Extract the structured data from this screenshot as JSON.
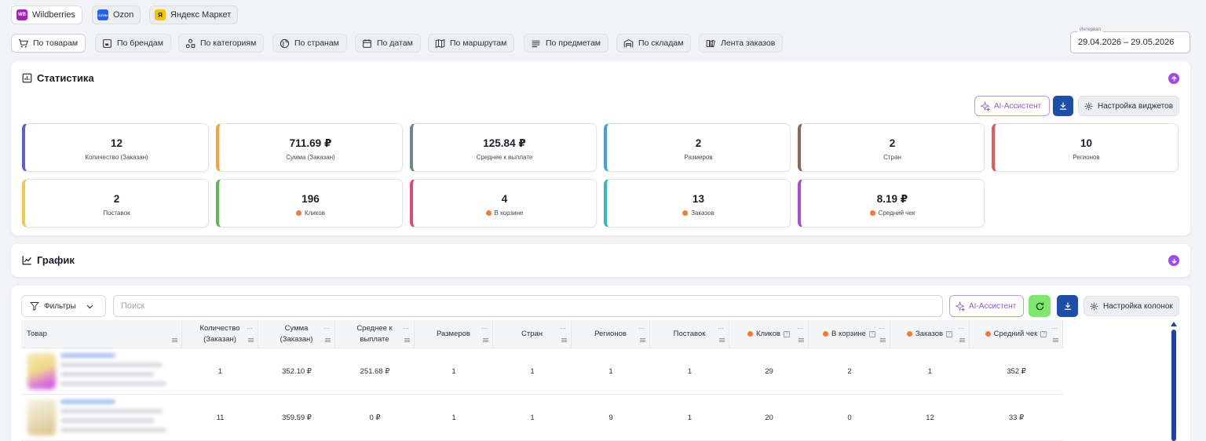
{
  "marketplaces": [
    {
      "label": "Wildberries",
      "logo_text": "WB",
      "color": "#a51fb8"
    },
    {
      "label": "Ozon",
      "logo_text": "OZON",
      "color": "#2563eb"
    },
    {
      "label": "Яндекс Маркет",
      "logo_text": "Я",
      "color": "#f7c400"
    }
  ],
  "nav": [
    {
      "label": "По товарам",
      "icon": "cart-icon"
    },
    {
      "label": "По брендам",
      "icon": "brand-icon"
    },
    {
      "label": "По категориям",
      "icon": "categories-icon"
    },
    {
      "label": "По странам",
      "icon": "globe-icon"
    },
    {
      "label": "По датам",
      "icon": "calendar-icon"
    },
    {
      "label": "По маршрутам",
      "icon": "map-icon"
    },
    {
      "label": "По предметам",
      "icon": "list-icon"
    },
    {
      "label": "По складам",
      "icon": "warehouse-icon"
    },
    {
      "label": "Лента заказов",
      "icon": "feed-icon"
    }
  ],
  "date_range": {
    "label": "Интервал",
    "value": "29.04.2026 – 29.05.2026"
  },
  "stats": {
    "title": "Статистика",
    "ai_label": "AI-Ассистент",
    "settings_label": "Настройка виджетов",
    "cards": [
      {
        "value": "12",
        "label": "Количество (Заказан)",
        "color": "#5b5fc7",
        "dot": false
      },
      {
        "value": "711.69 ₽",
        "label": "Сумма (Заказан)",
        "color": "#f5a43c",
        "dot": false
      },
      {
        "value": "125.84 ₽",
        "label": "Среднее к выплате",
        "color": "#6b8594",
        "dot": false
      },
      {
        "value": "2",
        "label": "Размеров",
        "color": "#3aa3e0",
        "dot": false
      },
      {
        "value": "2",
        "label": "Стран",
        "color": "#8a6a55",
        "dot": false
      },
      {
        "value": "10",
        "label": "Регионов",
        "color": "#e35a5a",
        "dot": false
      },
      {
        "value": "2",
        "label": "Поставок",
        "color": "#f2c94c",
        "dot": false
      },
      {
        "value": "196",
        "label": "Кликов",
        "color": "#5fb55f",
        "dot": true
      },
      {
        "value": "4",
        "label": "В корзине",
        "color": "#e04875",
        "dot": true
      },
      {
        "value": "13",
        "label": "Заказов",
        "color": "#37b7c4",
        "dot": true
      },
      {
        "value": "8.19 ₽",
        "label": "Средний чек",
        "color": "#a84fd1",
        "dot": true
      }
    ]
  },
  "graph": {
    "title": "График"
  },
  "table": {
    "filters_label": "Фильтры",
    "search_placeholder": "Поиск",
    "ai_label": "AI-Ассистент",
    "columns_settings_label": "Настройка колонок",
    "columns": [
      {
        "label": "Товар",
        "dot": false,
        "help": false
      },
      {
        "label": "Количество (Заказан)",
        "dot": false,
        "help": false
      },
      {
        "label": "Сумма (Заказан)",
        "dot": false,
        "help": false
      },
      {
        "label": "Среднее к выплате",
        "dot": false,
        "help": false
      },
      {
        "label": "Размеров",
        "dot": false,
        "help": false
      },
      {
        "label": "Стран",
        "dot": false,
        "help": false
      },
      {
        "label": "Регионов",
        "dot": false,
        "help": false
      },
      {
        "label": "Поставок",
        "dot": false,
        "help": false
      },
      {
        "label": "Кликов",
        "dot": true,
        "help": true
      },
      {
        "label": "В корзине",
        "dot": true,
        "help": true
      },
      {
        "label": "Заказов",
        "dot": true,
        "help": true
      },
      {
        "label": "Средний чек",
        "dot": true,
        "help": true
      }
    ],
    "rows": [
      [
        "1",
        "352.10 ₽",
        "251.68 ₽",
        "1",
        "1",
        "1",
        "1",
        "29",
        "2",
        "1",
        "352 ₽"
      ],
      [
        "11",
        "359.59 ₽",
        "0 ₽",
        "1",
        "1",
        "9",
        "1",
        "20",
        "0",
        "12",
        "33 ₽"
      ]
    ]
  }
}
